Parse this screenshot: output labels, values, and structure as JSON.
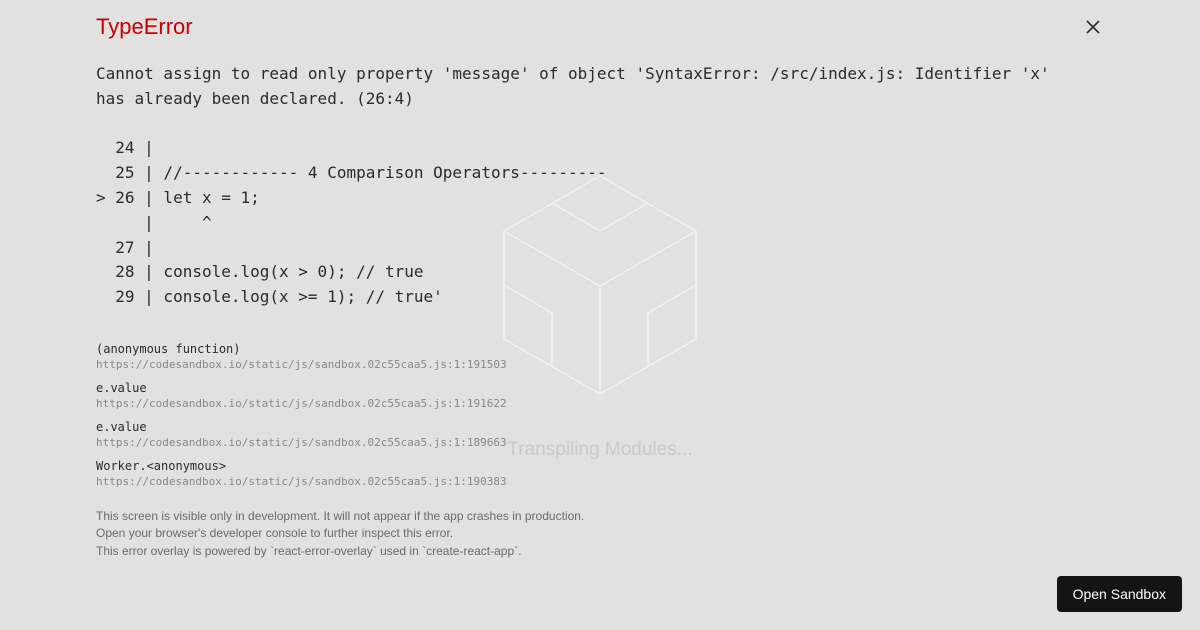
{
  "background": {
    "status_text": "Transpiling Modules..."
  },
  "error": {
    "title": "TypeError",
    "message_line1": "Cannot assign to read only property 'message' of object 'SyntaxError: /src/index.js: Identifier 'x'",
    "message_line2": "has already been declared. (26:4)",
    "code": {
      "l1": "  24 | ",
      "l2": "  25 | //------------ 4 Comparison Operators---------",
      "l3": "> 26 | let x = 1;",
      "l4": "     |     ^",
      "l5": "  27 | ",
      "l6": "  28 | console.log(x > 0); // true",
      "l7": "  29 | console.log(x >= 1); // true'"
    },
    "stack": [
      {
        "fn": "(anonymous function)",
        "src": "https://codesandbox.io/static/js/sandbox.02c55caa5.js:1:191503"
      },
      {
        "fn": "e.value",
        "src": "https://codesandbox.io/static/js/sandbox.02c55caa5.js:1:191622"
      },
      {
        "fn": "e.value",
        "src": "https://codesandbox.io/static/js/sandbox.02c55caa5.js:1:189663"
      },
      {
        "fn": "Worker.<anonymous>",
        "src": "https://codesandbox.io/static/js/sandbox.02c55caa5.js:1:190383"
      }
    ],
    "footer": {
      "l1": "This screen is visible only in development. It will not appear if the app crashes in production.",
      "l2": "Open your browser's developer console to further inspect this error.",
      "l3": "This error overlay is powered by `react-error-overlay` used in `create-react-app`."
    }
  },
  "actions": {
    "open_sandbox": "Open Sandbox"
  }
}
